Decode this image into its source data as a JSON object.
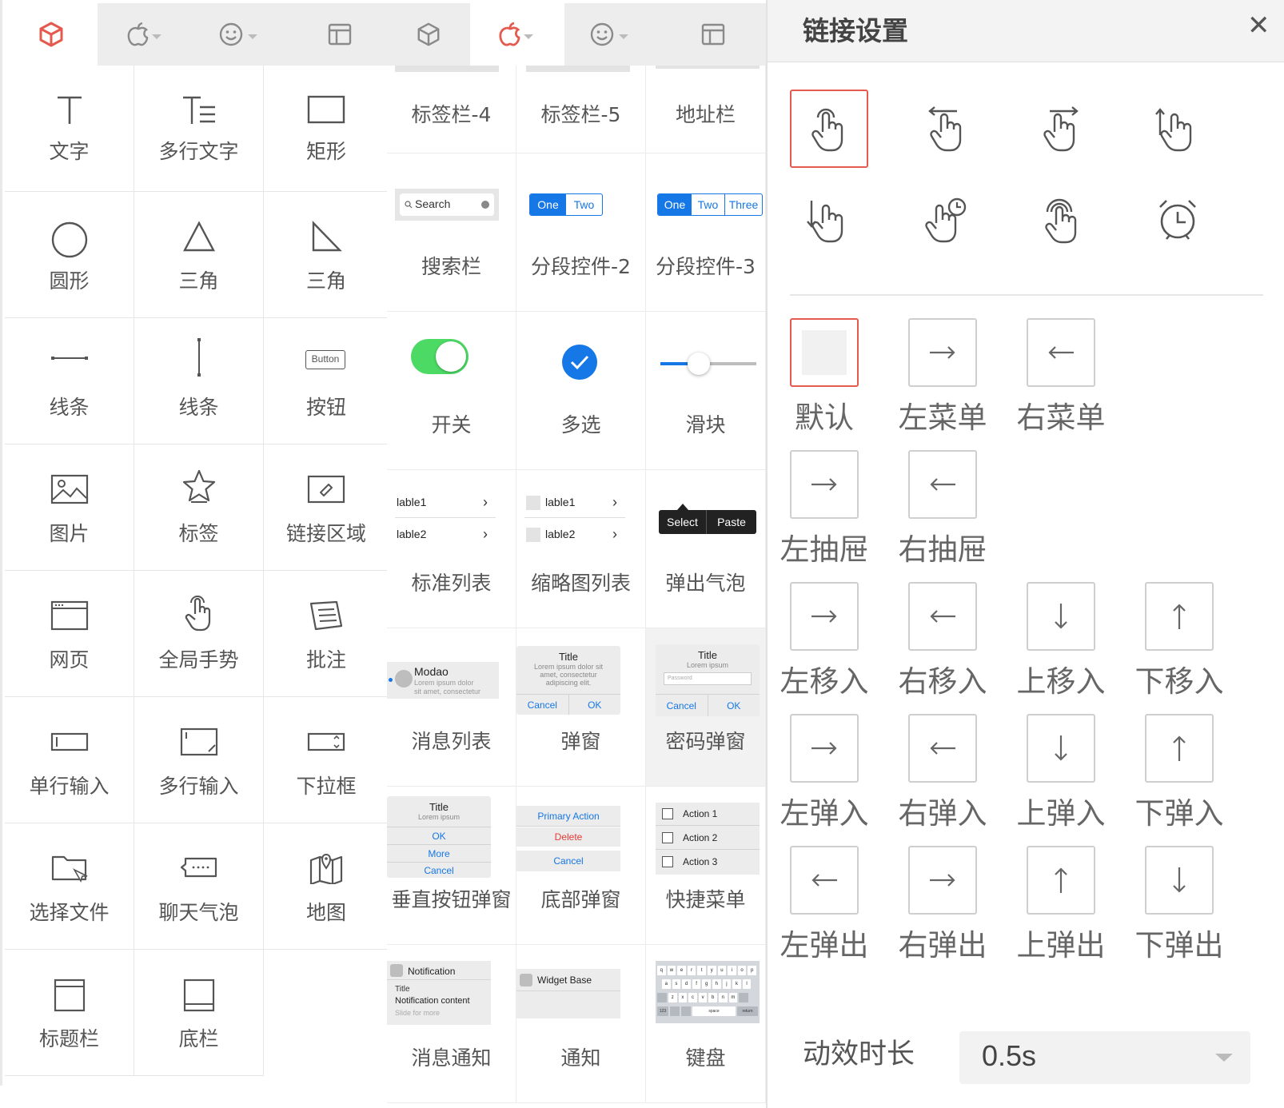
{
  "panel1": {
    "items": [
      {
        "label": "文字"
      },
      {
        "label": "多行文字"
      },
      {
        "label": "矩形"
      },
      {
        "label": "圆形"
      },
      {
        "label": "三角"
      },
      {
        "label": "三角"
      },
      {
        "label": "线条"
      },
      {
        "label": "线条"
      },
      {
        "label": "按钮"
      },
      {
        "label": "图片"
      },
      {
        "label": "标签"
      },
      {
        "label": "链接区域"
      },
      {
        "label": "网页"
      },
      {
        "label": "全局手势"
      },
      {
        "label": "批注"
      },
      {
        "label": "单行输入"
      },
      {
        "label": "多行输入"
      },
      {
        "label": "下拉框"
      },
      {
        "label": "选择文件"
      },
      {
        "label": "聊天气泡"
      },
      {
        "label": "地图"
      },
      {
        "label": "标题栏"
      },
      {
        "label": "底栏"
      }
    ],
    "button_icon_text": "Button"
  },
  "panel2": {
    "items": [
      {
        "label": "标签栏-4"
      },
      {
        "label": "标签栏-5"
      },
      {
        "label": "地址栏"
      },
      {
        "label": "搜索栏"
      },
      {
        "label": "分段控件-2"
      },
      {
        "label": "分段控件-3"
      },
      {
        "label": "开关"
      },
      {
        "label": "多选"
      },
      {
        "label": "滑块"
      },
      {
        "label": "标准列表"
      },
      {
        "label": "缩略图列表"
      },
      {
        "label": "弹出气泡"
      },
      {
        "label": "消息列表"
      },
      {
        "label": "弹窗"
      },
      {
        "label": "密码弹窗"
      },
      {
        "label": "垂直按钮弹窗"
      },
      {
        "label": "底部弹窗"
      },
      {
        "label": "快捷菜单"
      },
      {
        "label": "消息通知"
      },
      {
        "label": "通知"
      },
      {
        "label": "键盘"
      }
    ],
    "search_placeholder": "Search",
    "seg2": [
      "One",
      "Two"
    ],
    "seg3": [
      "One",
      "Two",
      "Three"
    ],
    "list1": [
      "lable1",
      "lable2"
    ],
    "list2": [
      "lable1",
      "lable2"
    ],
    "bubble": [
      "Select",
      "Paste"
    ],
    "msg": {
      "title": "Modao",
      "body1": "Lorem ipsum dolor",
      "body2": "sit amet, consectetur"
    },
    "alert": {
      "title": "Title",
      "body1": "Lorem ipsum dolor sit",
      "body2": "amet, consectetur",
      "body3": "adipiscing elit.",
      "cancel": "Cancel",
      "ok": "OK"
    },
    "pwd": {
      "title": "Title",
      "body": "Lorem ipsum",
      "placeholder": "Password",
      "cancel": "Cancel",
      "ok": "OK"
    },
    "vsheet": {
      "title": "Title",
      "body": "Lorem ipsum",
      "b1": "OK",
      "b2": "More",
      "b3": "Cancel"
    },
    "asheet": {
      "primary": "Primary Action",
      "delete": "Delete",
      "cancel": "Cancel"
    },
    "qmenu": [
      "Action 1",
      "Action 2",
      "Action 3"
    ],
    "notif": {
      "app": "Notification",
      "title": "Title",
      "content": "Notification content",
      "more": "Slide for more"
    },
    "widget": {
      "label": "Widget Base"
    },
    "kbd": {
      "row1": [
        "q",
        "w",
        "e",
        "r",
        "t",
        "y",
        "u",
        "i",
        "o",
        "p"
      ],
      "row2": [
        "a",
        "s",
        "d",
        "f",
        "g",
        "h",
        "j",
        "k",
        "l"
      ],
      "row3": [
        "z",
        "x",
        "c",
        "v",
        "b",
        "n",
        "m"
      ],
      "row4_num": "123",
      "row4_space": "space",
      "row4_return": "return"
    }
  },
  "panel3": {
    "title": "链接设置",
    "close": "✕",
    "transitions": [
      {
        "label": "默认"
      },
      {
        "label": "左菜单"
      },
      {
        "label": "右菜单"
      },
      {
        "label": "左抽屉"
      },
      {
        "label": "右抽屉"
      },
      {
        "label": "左移入"
      },
      {
        "label": "右移入"
      },
      {
        "label": "上移入"
      },
      {
        "label": "下移入"
      },
      {
        "label": "左弹入"
      },
      {
        "label": "右弹入"
      },
      {
        "label": "上弹入"
      },
      {
        "label": "下弹入"
      },
      {
        "label": "左弹出"
      },
      {
        "label": "右弹出"
      },
      {
        "label": "上弹出"
      },
      {
        "label": "下弹出"
      }
    ],
    "duration_label": "动效时长",
    "duration_value": "0.5s"
  },
  "colors": {
    "accent": "#e55a4e",
    "ios_blue": "#1677e6",
    "switch_green": "#4cd964"
  }
}
